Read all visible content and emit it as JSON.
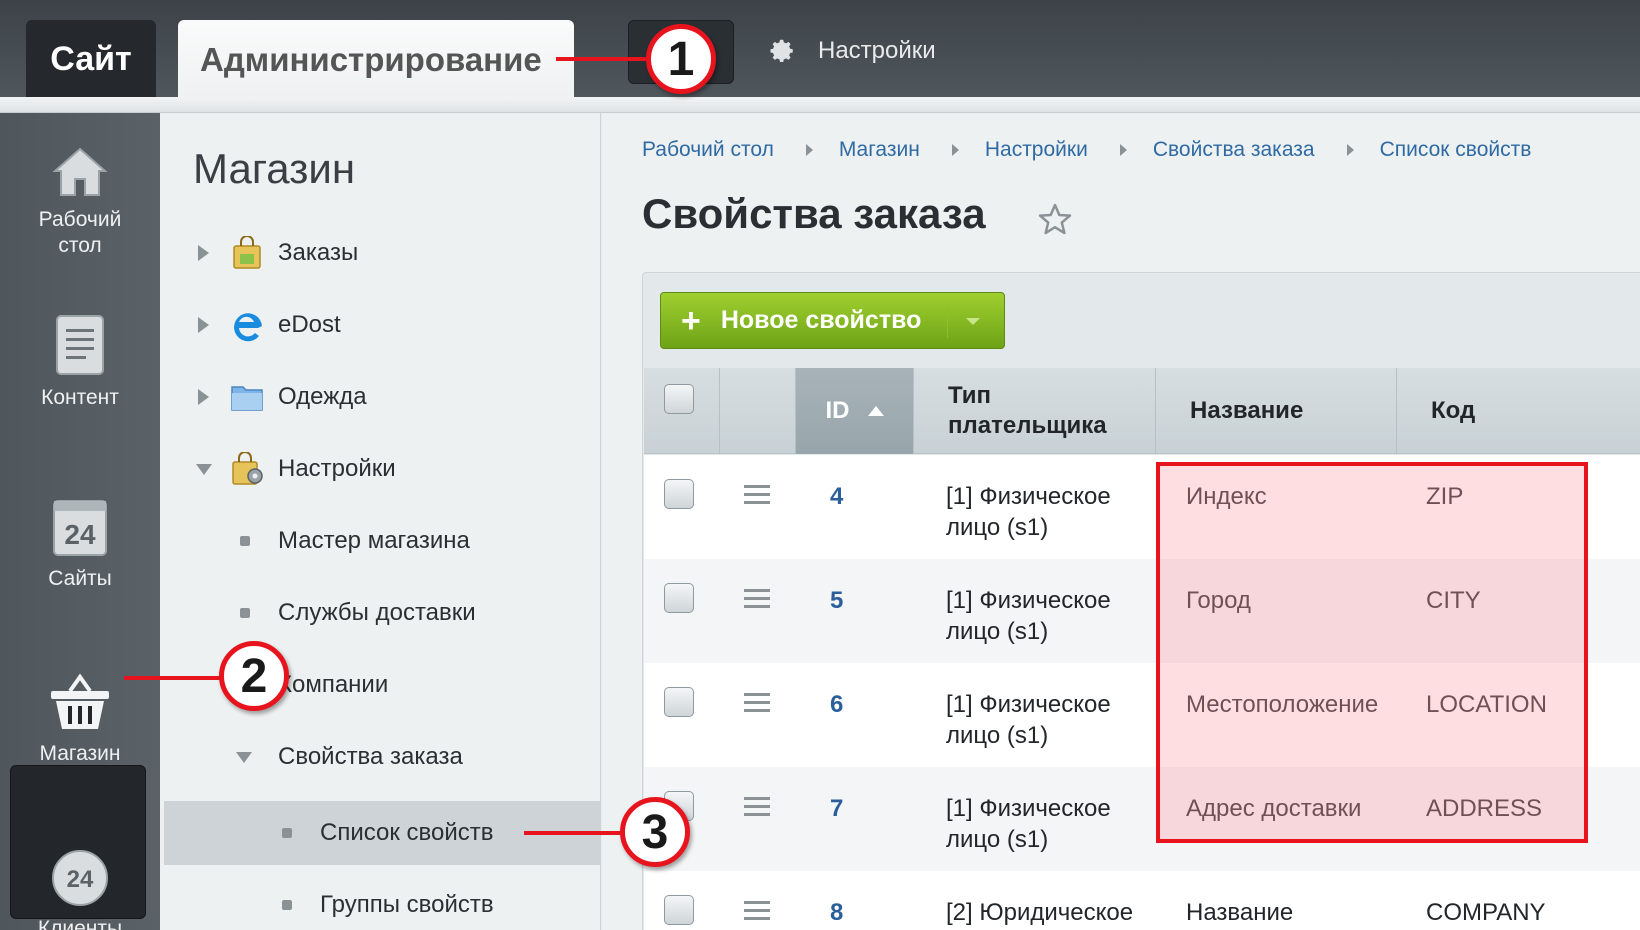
{
  "topbar": {
    "site_tab": "Сайт",
    "admin_tab": "Администрирование",
    "settings_label": "Настройки"
  },
  "rail": {
    "items": [
      {
        "label": "Рабочий\nстол",
        "icon": "home-icon"
      },
      {
        "label": "Контент",
        "icon": "document-icon"
      },
      {
        "label": "Сайты",
        "icon": "calendar-24-icon"
      },
      {
        "label": "Магазин",
        "icon": "basket-icon"
      },
      {
        "label": "Клиенты",
        "icon": "clients-24-icon"
      }
    ]
  },
  "tree": {
    "title": "Магазин",
    "items": [
      {
        "label": "Заказы"
      },
      {
        "label": "eDost"
      },
      {
        "label": "Одежда"
      },
      {
        "label": "Настройки"
      },
      {
        "label": "Мастер магазина"
      },
      {
        "label": "Службы доставки"
      },
      {
        "label": "Компании"
      },
      {
        "label": "Свойства заказа"
      },
      {
        "label": "Список свойств"
      },
      {
        "label": "Группы свойств"
      }
    ]
  },
  "breadcrumbs": [
    "Рабочий стол",
    "Магазин",
    "Настройки",
    "Свойства заказа",
    "Список свойств"
  ],
  "page": {
    "title": "Свойства заказа",
    "new_button": "Новое свойство"
  },
  "table": {
    "headers": {
      "id": "ID",
      "payer": "Тип плательщика",
      "name": "Название",
      "code": "Код"
    },
    "rows": [
      {
        "id": "4",
        "payer_line1": "[1] Физическое",
        "payer_line2": "лицо (s1)",
        "name": "Индекс",
        "code": "ZIP"
      },
      {
        "id": "5",
        "payer_line1": "[1] Физическое",
        "payer_line2": "лицо (s1)",
        "name": "Город",
        "code": "CITY"
      },
      {
        "id": "6",
        "payer_line1": "[1] Физическое",
        "payer_line2": "лицо (s1)",
        "name": "Местоположение",
        "code": "LOCATION"
      },
      {
        "id": "7",
        "payer_line1": "[1] Физическое",
        "payer_line2": "лицо (s1)",
        "name": "Адрес доставки",
        "code": "ADDRESS"
      },
      {
        "id": "8",
        "payer_line1": "[2] Юридическое",
        "payer_line2": "",
        "name": "Название",
        "code": "COMPANY"
      }
    ]
  },
  "callouts": [
    "1",
    "2",
    "3"
  ],
  "colors": {
    "accent_red": "#e8141d",
    "button_green": "#7cb51f",
    "link_blue": "#2a5f9c"
  }
}
